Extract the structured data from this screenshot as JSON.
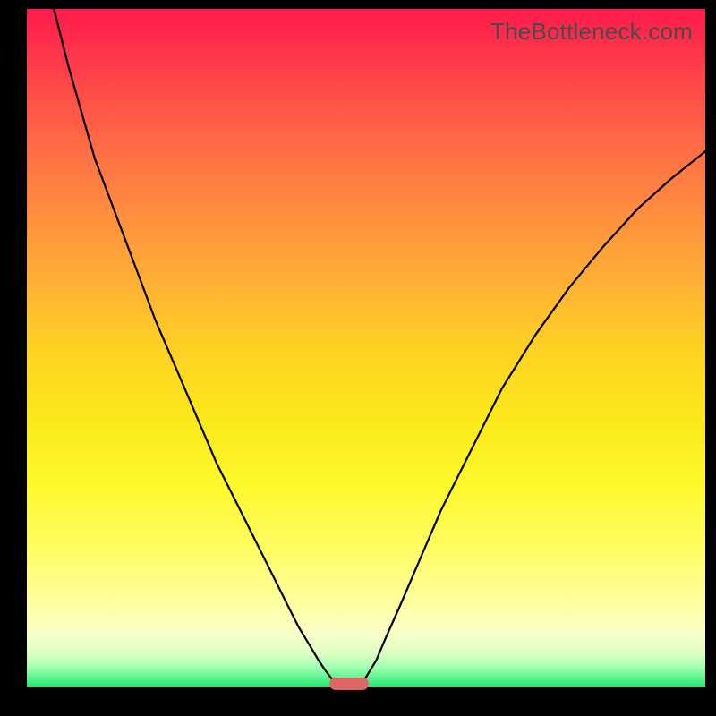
{
  "watermark": "TheBottleneck.com",
  "colors": {
    "frame": "#000000",
    "curve": "#000000",
    "marker": "#e06666",
    "gradient_top": "#ff1a4d",
    "gradient_bottom": "#22e66f"
  },
  "chart_data": {
    "type": "line",
    "title": "",
    "xlabel": "",
    "ylabel": "",
    "x_range": [
      0,
      100
    ],
    "y_range": [
      0,
      100
    ],
    "series": [
      {
        "name": "left-branch",
        "x": [
          4.0,
          6.0,
          8.0,
          10.0,
          13.0,
          16.0,
          19.0,
          22.0,
          25.0,
          28.0,
          31.0,
          34.0,
          36.0,
          38.0,
          40.0,
          41.5,
          43.0,
          44.0,
          45.0,
          46.0
        ],
        "y": [
          100,
          92,
          85,
          78,
          70,
          62,
          54,
          47,
          40,
          33,
          27,
          21,
          17,
          13,
          9,
          6.5,
          4,
          2.5,
          1.2,
          0.3
        ]
      },
      {
        "name": "right-branch",
        "x": [
          49.0,
          50.0,
          51.5,
          53.0,
          55.0,
          58.0,
          61.0,
          65.0,
          70.0,
          75.0,
          80.0,
          85.0,
          90.0,
          95.0,
          100.0
        ],
        "y": [
          0.3,
          1.5,
          4.0,
          7.5,
          12.0,
          19.0,
          26.0,
          34.0,
          44.0,
          52.0,
          59.0,
          65.0,
          70.5,
          75.0,
          79.0
        ]
      }
    ],
    "marker": {
      "x": 47.5,
      "y": 0.5
    },
    "annotations": [
      {
        "text": "TheBottleneck.com",
        "role": "watermark"
      }
    ]
  }
}
